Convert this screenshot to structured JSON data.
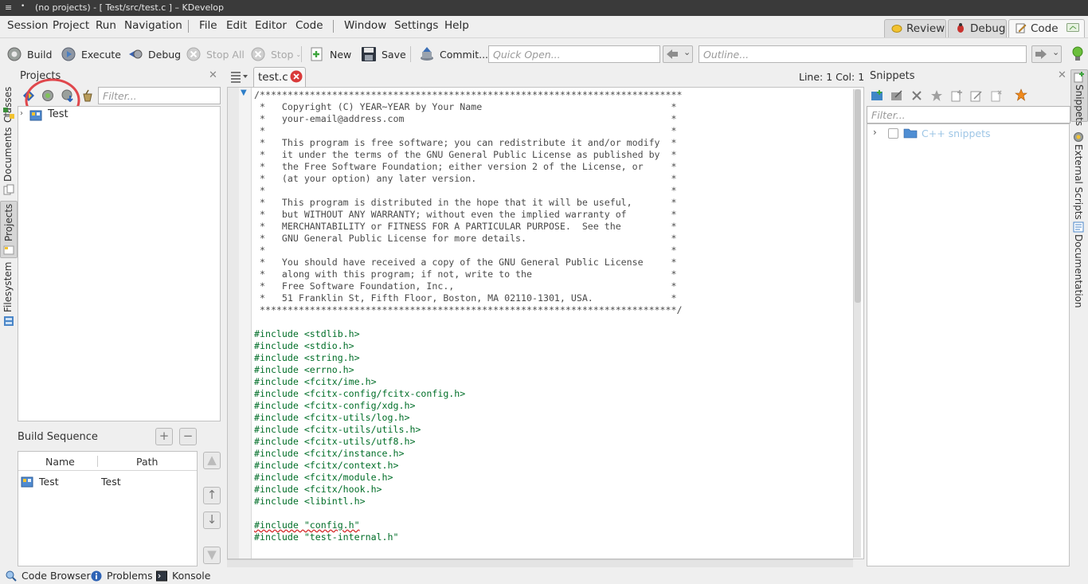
{
  "window": {
    "title": "(no projects) - [ Test/src/test.c ] – KDevelop"
  },
  "menubar": {
    "items": [
      "Session",
      "Project",
      "Run",
      "Navigation",
      "File",
      "Edit",
      "Editor",
      "Code",
      "Window",
      "Settings",
      "Help"
    ]
  },
  "areas": {
    "review": "Review",
    "debug": "Debug",
    "code": "Code",
    "active": "Code"
  },
  "toolbar": {
    "build": "Build",
    "execute": "Execute",
    "debug": "Debug",
    "stop_all": "Stop All",
    "stop": "Stop",
    "new": "New",
    "save": "Save",
    "commit": "Commit...",
    "quick_open_placeholder": "Quick Open...",
    "outline_placeholder": "Outline..."
  },
  "left_tabs": [
    "Classes",
    "Documents",
    "Projects",
    "Filesystem"
  ],
  "projects": {
    "title": "Projects",
    "filter_placeholder": "Filter...",
    "tree": [
      {
        "name": "Test"
      }
    ]
  },
  "build_sequence": {
    "title": "Build Sequence",
    "columns": [
      "Name",
      "Path"
    ],
    "rows": [
      {
        "name": "Test",
        "path": "Test"
      }
    ]
  },
  "editor": {
    "tab": "test.c",
    "cursor": "Line: 1 Col: 1",
    "code_lines": [
      {
        "t": "/****************************************************************************",
        "c": "cmt"
      },
      {
        "t": " *   Copyright (C) YEAR~YEAR by Your Name                                  *",
        "c": "cmt"
      },
      {
        "t": " *   your-email@address.com                                                *",
        "c": "cmt"
      },
      {
        "t": " *                                                                         *",
        "c": "cmt"
      },
      {
        "t": " *   This program is free software; you can redistribute it and/or modify  *",
        "c": "cmt"
      },
      {
        "t": " *   it under the terms of the GNU General Public License as published by  *",
        "c": "cmt"
      },
      {
        "t": " *   the Free Software Foundation; either version 2 of the License, or     *",
        "c": "cmt"
      },
      {
        "t": " *   (at your option) any later version.                                   *",
        "c": "cmt"
      },
      {
        "t": " *                                                                         *",
        "c": "cmt"
      },
      {
        "t": " *   This program is distributed in the hope that it will be useful,       *",
        "c": "cmt"
      },
      {
        "t": " *   but WITHOUT ANY WARRANTY; without even the implied warranty of        *",
        "c": "cmt"
      },
      {
        "t": " *   MERCHANTABILITY or FITNESS FOR A PARTICULAR PURPOSE.  See the         *",
        "c": "cmt"
      },
      {
        "t": " *   GNU General Public License for more details.                          *",
        "c": "cmt"
      },
      {
        "t": " *                                                                         *",
        "c": "cmt"
      },
      {
        "t": " *   You should have received a copy of the GNU General Public License     *",
        "c": "cmt"
      },
      {
        "t": " *   along with this program; if not, write to the                         *",
        "c": "cmt"
      },
      {
        "t": " *   Free Software Foundation, Inc.,                                       *",
        "c": "cmt"
      },
      {
        "t": " *   51 Franklin St, Fifth Floor, Boston, MA 02110-1301, USA.              *",
        "c": "cmt"
      },
      {
        "t": " ***************************************************************************/",
        "c": "cmt"
      },
      {
        "t": "",
        "c": ""
      },
      {
        "t": "#include <stdlib.h>",
        "c": "inc"
      },
      {
        "t": "#include <stdio.h>",
        "c": "inc"
      },
      {
        "t": "#include <string.h>",
        "c": "inc"
      },
      {
        "t": "#include <errno.h>",
        "c": "inc"
      },
      {
        "t": "#include <fcitx/ime.h>",
        "c": "inc"
      },
      {
        "t": "#include <fcitx-config/fcitx-config.h>",
        "c": "inc"
      },
      {
        "t": "#include <fcitx-config/xdg.h>",
        "c": "inc"
      },
      {
        "t": "#include <fcitx-utils/log.h>",
        "c": "inc"
      },
      {
        "t": "#include <fcitx-utils/utils.h>",
        "c": "inc"
      },
      {
        "t": "#include <fcitx-utils/utf8.h>",
        "c": "inc"
      },
      {
        "t": "#include <fcitx/instance.h>",
        "c": "inc"
      },
      {
        "t": "#include <fcitx/context.h>",
        "c": "inc"
      },
      {
        "t": "#include <fcitx/module.h>",
        "c": "inc"
      },
      {
        "t": "#include <fcitx/hook.h>",
        "c": "inc"
      },
      {
        "t": "#include <libintl.h>",
        "c": "inc"
      },
      {
        "t": "",
        "c": ""
      },
      {
        "t": "#include \"config.h\"",
        "c": "inc err"
      },
      {
        "t": "#include \"test-internal.h\"",
        "c": "inc"
      }
    ]
  },
  "snippets": {
    "title": "Snippets",
    "filter_placeholder": "Filter...",
    "tree": [
      {
        "name": "C++ snippets"
      }
    ]
  },
  "right_tabs": [
    "Snippets",
    "External Scripts",
    "Documentation"
  ],
  "statusbar": {
    "items": [
      "Code Browser",
      "Problems",
      "Konsole"
    ]
  },
  "colors": {
    "accent_highlight": "#e0474c",
    "include_green": "#006e28",
    "error_underline": "#d21c1c",
    "snippet_folder_text": "#9ec6e6"
  }
}
